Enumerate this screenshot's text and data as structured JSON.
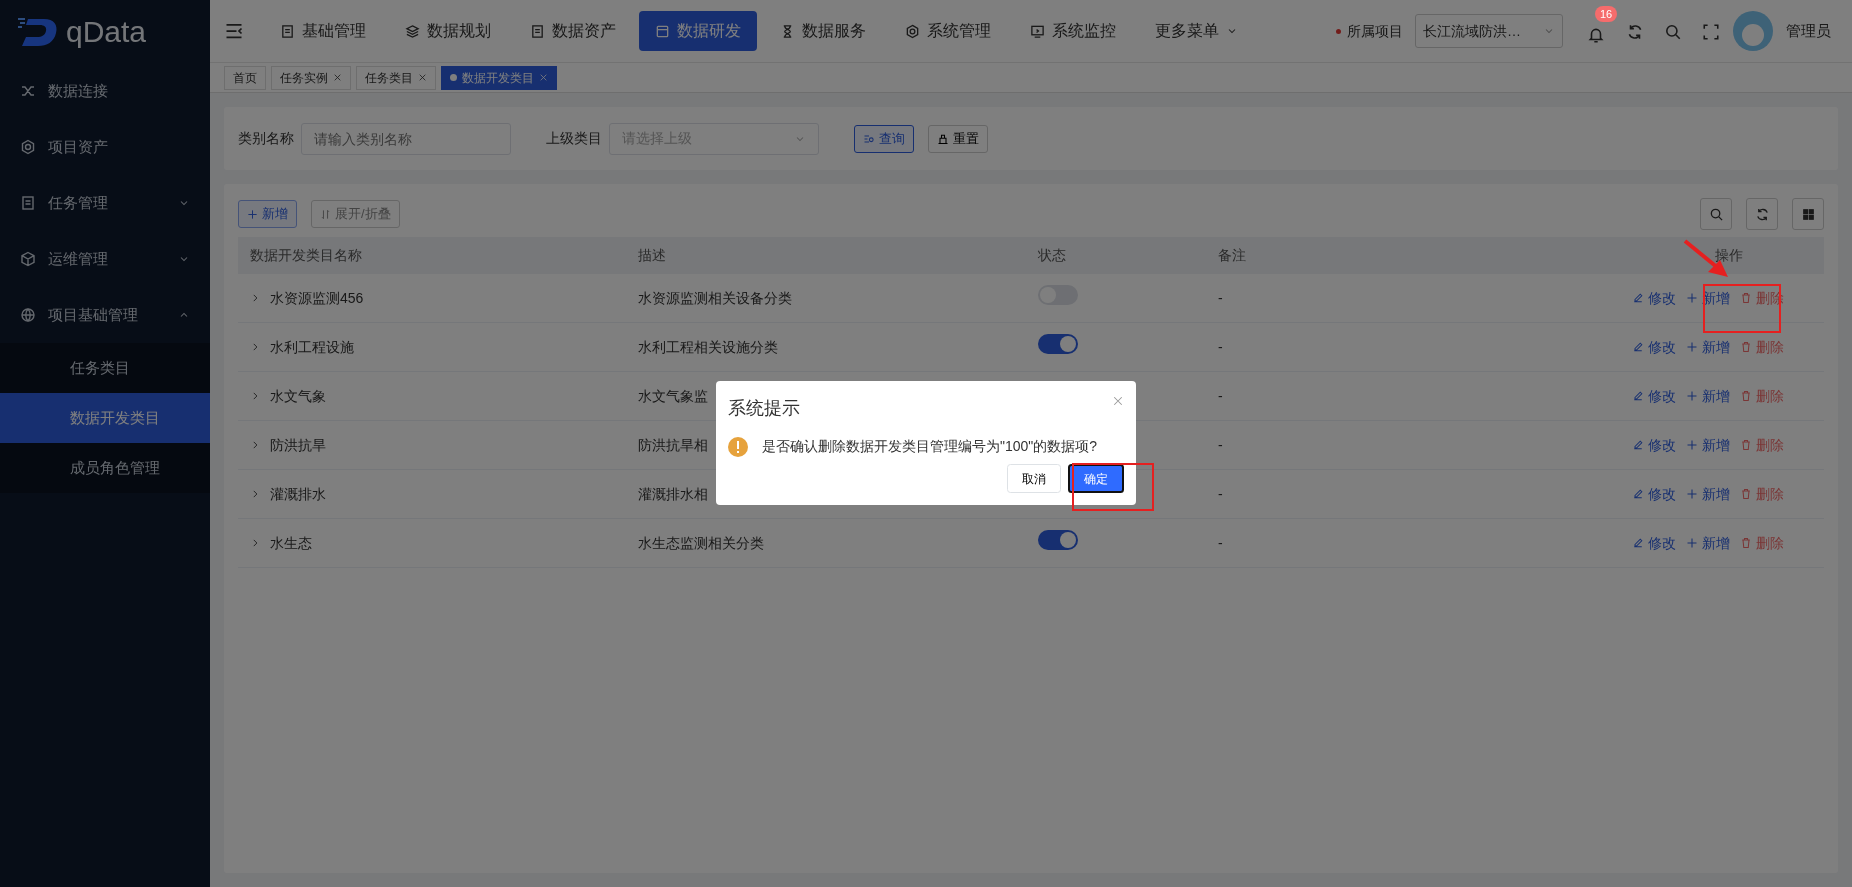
{
  "logo": {
    "text": "qData"
  },
  "sidebar": {
    "items": [
      {
        "label": "数据连接",
        "expandable": false,
        "expanded": false,
        "selected": false
      },
      {
        "label": "项目资产",
        "expandable": false,
        "expanded": false,
        "selected": false
      },
      {
        "label": "任务管理",
        "expandable": true,
        "expanded": false,
        "selected": false
      },
      {
        "label": "运维管理",
        "expandable": true,
        "expanded": false,
        "selected": false
      },
      {
        "label": "项目基础管理",
        "expandable": true,
        "expanded": true,
        "selected": false,
        "children": [
          {
            "label": "任务类目",
            "selected": false
          },
          {
            "label": "数据开发类目",
            "selected": true
          },
          {
            "label": "成员角色管理",
            "selected": false
          }
        ]
      }
    ]
  },
  "top_menu": [
    {
      "label": "基础管理",
      "selected": false
    },
    {
      "label": "数据规划",
      "selected": false
    },
    {
      "label": "数据资产",
      "selected": false
    },
    {
      "label": "数据研发",
      "selected": true
    },
    {
      "label": "数据服务",
      "selected": false
    },
    {
      "label": "系统管理",
      "selected": false
    },
    {
      "label": "系统监控",
      "selected": false
    },
    {
      "label": "更多菜单",
      "selected": false
    }
  ],
  "project": {
    "label": "所属项目",
    "value": "长江流域防洪…"
  },
  "notifications": {
    "count": "16"
  },
  "user": {
    "name": "管理员"
  },
  "tabs": [
    {
      "label": "首页",
      "closable": false,
      "selected": false
    },
    {
      "label": "任务实例",
      "closable": true,
      "selected": false
    },
    {
      "label": "任务类目",
      "closable": true,
      "selected": false
    },
    {
      "label": "数据开发类目",
      "closable": true,
      "selected": true
    }
  ],
  "search": {
    "fields": [
      {
        "label": "类别名称",
        "placeholder": "请输入类别名称",
        "kind": "input"
      },
      {
        "label": "上级类目",
        "placeholder": "请选择上级",
        "kind": "select"
      }
    ],
    "query_button": "查询",
    "reset_button": "重置"
  },
  "toolbar": {
    "add_button": "新增",
    "expand_button": "展开/折叠"
  },
  "table": {
    "columns": [
      "数据开发类目名称",
      "描述",
      "状态",
      "备注",
      "操作"
    ],
    "rows": [
      {
        "name": "水资源监测456",
        "description": "水资源监测相关设备分类",
        "on": false,
        "remark": "-",
        "actions": [
          "修改",
          "新增",
          "删除"
        ]
      },
      {
        "name": "水利工程设施",
        "description": "水利工程相关设施分类",
        "on": true,
        "remark": "-",
        "actions": [
          "修改",
          "新增",
          "删除"
        ]
      },
      {
        "name": "水文气象",
        "description": "水文气象监",
        "remark": "-",
        "actions": [
          "修改",
          "新增",
          "删除"
        ]
      },
      {
        "name": "防洪抗旱",
        "description": "防洪抗旱相",
        "remark": "-",
        "actions": [
          "修改",
          "新增",
          "删除"
        ]
      },
      {
        "name": "灌溉排水",
        "description": "灌溉排水相",
        "remark": "-",
        "actions": [
          "修改",
          "新增",
          "删除"
        ]
      },
      {
        "name": "水生态",
        "description": "水生态监测相关分类",
        "on": true,
        "remark": "-",
        "actions": [
          "修改",
          "新增",
          "删除"
        ]
      }
    ]
  },
  "dialog": {
    "title": "系统提示",
    "message": "是否确认删除数据开发类目管理编号为\"100\"的数据项?",
    "cancel": "取消",
    "confirm": "确定"
  }
}
